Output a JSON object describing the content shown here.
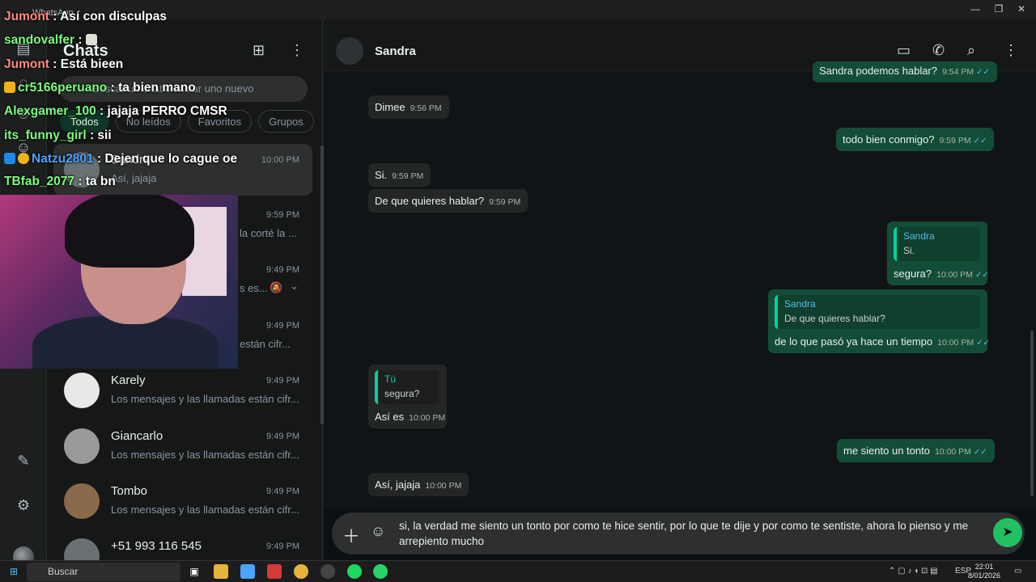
{
  "window": {
    "title": "WhatsApp",
    "min": "—",
    "max": "❐",
    "close": "✕"
  },
  "rail": {
    "chats_icon": "chats-icon",
    "status_icon": "status-icon",
    "channels_icon": "channels-icon",
    "settings_icon": "⚙",
    "starred_icon": "✎"
  },
  "list": {
    "title": "Chats",
    "new_chat_icon": "⊞",
    "menu_icon": "⋮",
    "search_placeholder": "Buscar un chat o iniciar uno nuevo",
    "filters": [
      "Todos",
      "No leídos",
      "Favoritos",
      "Grupos"
    ],
    "rows": [
      {
        "name": "Sandra",
        "preview": "Así, jajaja",
        "time": "10:00 PM"
      },
      {
        "name": "",
        "preview": "la corté la ...",
        "time": "9:59 PM"
      },
      {
        "name": "",
        "preview": "s es...",
        "time": "9:49 PM"
      },
      {
        "name": "",
        "preview": "están cifr...",
        "time": "9:49 PM"
      },
      {
        "name": "Karely",
        "preview": "Los mensajes y las llamadas están cifr...",
        "time": "9:49 PM"
      },
      {
        "name": "Giancarlo",
        "preview": "Los mensajes y las llamadas están cifr...",
        "time": "9:49 PM"
      },
      {
        "name": "Tombo",
        "preview": "Los mensajes y las llamadas están cifr...",
        "time": "9:49 PM"
      },
      {
        "name": "+51 993 116 545",
        "preview": "",
        "time": "9:49 PM"
      }
    ]
  },
  "chat": {
    "contact": "Sandra",
    "icons": {
      "video": "▭",
      "call": "✆",
      "search": "⌕",
      "menu": "⋮"
    },
    "messages": [
      {
        "text": "Sandra podemos hablar?",
        "time": "9:54 PM"
      },
      {
        "text": "Dimee",
        "time": "9:56 PM"
      },
      {
        "text": "todo bien conmigo?",
        "time": "9:59 PM"
      },
      {
        "text": "Si.",
        "time": "9:59 PM"
      },
      {
        "text": "De que quieres hablar?",
        "time": "9:59 PM"
      },
      {
        "quote_name": "Sandra",
        "quote_text": "Si.",
        "text": "segura?",
        "time": "10:00 PM"
      },
      {
        "quote_name": "Sandra",
        "quote_text": "De que quieres hablar?",
        "text": "de lo que pasó ya hace un tiempo",
        "time": "10:00 PM"
      },
      {
        "quote_name": "Tú",
        "quote_text": "segura?",
        "text": "Así es",
        "time": "10:00 PM"
      },
      {
        "text": "me siento un tonto",
        "time": "10:00 PM"
      },
      {
        "text": "Así, jajaja",
        "time": "10:00 PM"
      }
    ],
    "ticks": "✓✓",
    "composer_text": "si, la verdad me siento un tonto por como te hice sentir, por lo que te dije y por como te sentiste, ahora lo pienso y me arrepiento mucho"
  },
  "overlay": [
    {
      "user": "Jumont",
      "text": "Así con disculpas",
      "color": "#ff8a80"
    },
    {
      "user": "sandovalfer",
      "text": "",
      "color": "#7dff7d"
    },
    {
      "user": "Jumont",
      "text": "Está bieen",
      "color": "#ff8a80"
    },
    {
      "user": "cr5166peruano",
      "text": "ta bien mano",
      "color": "#7dff7d"
    },
    {
      "user": "Alexgamer_100",
      "text": "jajaja PERRO CMSR",
      "color": "#7dff7d"
    },
    {
      "user": "its_funny_girl",
      "text": "sii",
      "color": "#7dff7d"
    },
    {
      "user": "Natzu2801",
      "text": "Dejen que lo cague oe",
      "color": "#4aa3ff"
    },
    {
      "user": "TBfab_2077",
      "text": "ta bn",
      "color": "#7dff7d"
    }
  ],
  "taskbar": {
    "search": "Buscar",
    "lang": "ESP",
    "time": "22:01",
    "date": "8/01/2026"
  }
}
